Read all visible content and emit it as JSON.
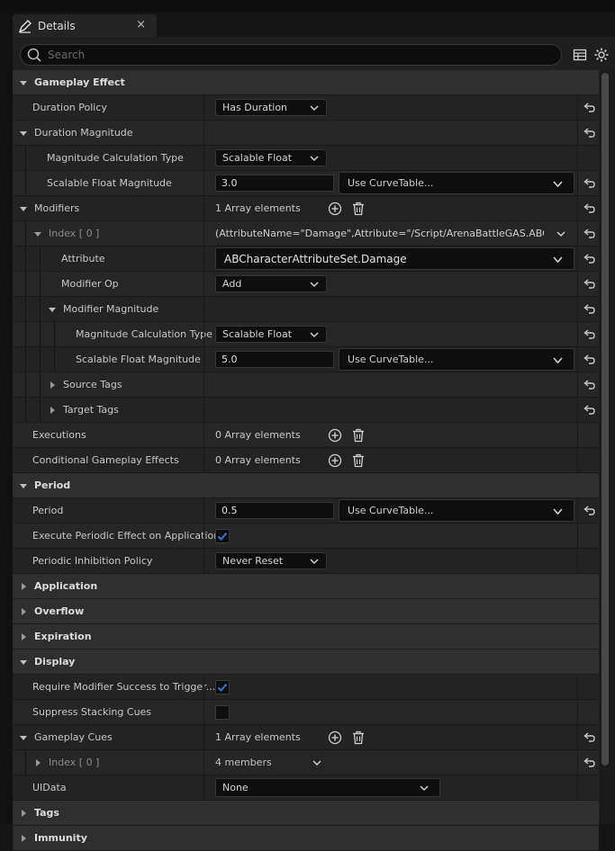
{
  "tab": {
    "title": "Details",
    "close": "×"
  },
  "search": {
    "placeholder": "Search"
  },
  "rows": {
    "gameplay_effect": "Gameplay Effect",
    "duration_policy": {
      "label": "Duration Policy",
      "value": "Has Duration"
    },
    "duration_magnitude": "Duration Magnitude",
    "mag_calc_type": {
      "label": "Magnitude Calculation Type",
      "value": "Scalable Float"
    },
    "scalable_float": {
      "label": "Scalable Float Magnitude",
      "value": "3.0",
      "curve": "Use CurveTable..."
    },
    "modifiers": {
      "label": "Modifiers",
      "count": "1 Array elements"
    },
    "index0": {
      "label": "Index [ 0 ]",
      "summary": "(AttributeName=\"Damage\",Attribute=\"/Script/ArenaBattleGAS.ABCharac"
    },
    "attribute": {
      "label": "Attribute",
      "value": "ABCharacterAttributeSet.Damage"
    },
    "modifier_op": {
      "label": "Modifier Op",
      "value": "Add"
    },
    "modifier_magnitude": "Modifier Magnitude",
    "mm_calc_type": {
      "label": "Magnitude Calculation Type",
      "value": "Scalable Float"
    },
    "mm_scalable": {
      "label": "Scalable Float Magnitude",
      "value": "5.0",
      "curve": "Use CurveTable..."
    },
    "source_tags": "Source Tags",
    "target_tags": "Target Tags",
    "executions": {
      "label": "Executions",
      "count": "0 Array elements"
    },
    "conditional": {
      "label": "Conditional Gameplay Effects",
      "count": "0 Array elements"
    },
    "period_cat": "Period",
    "period": {
      "label": "Period",
      "value": "0.5",
      "curve": "Use CurveTable..."
    },
    "exec_periodic": {
      "label": "Execute Periodic Effect on Application",
      "checked": true
    },
    "inhibition": {
      "label": "Periodic Inhibition Policy",
      "value": "Never Reset"
    },
    "application": "Application",
    "overflow": "Overflow",
    "expiration": "Expiration",
    "display": "Display",
    "require_modifier": {
      "label": "Require Modifier Success to Trigger...",
      "checked": true
    },
    "suppress_stacking": {
      "label": "Suppress Stacking Cues",
      "checked": false
    },
    "gameplay_cues": {
      "label": "Gameplay Cues",
      "count": "1 Array elements"
    },
    "cue_index0": {
      "label": "Index [ 0 ]",
      "value": "4 members"
    },
    "uidata": {
      "label": "UIData",
      "value": "None"
    },
    "tags": "Tags",
    "immunity": "Immunity"
  },
  "colors": {
    "accent_check": "#2f7ad9",
    "category_bg": "#2f2f2f",
    "row_bg": "#232323"
  }
}
